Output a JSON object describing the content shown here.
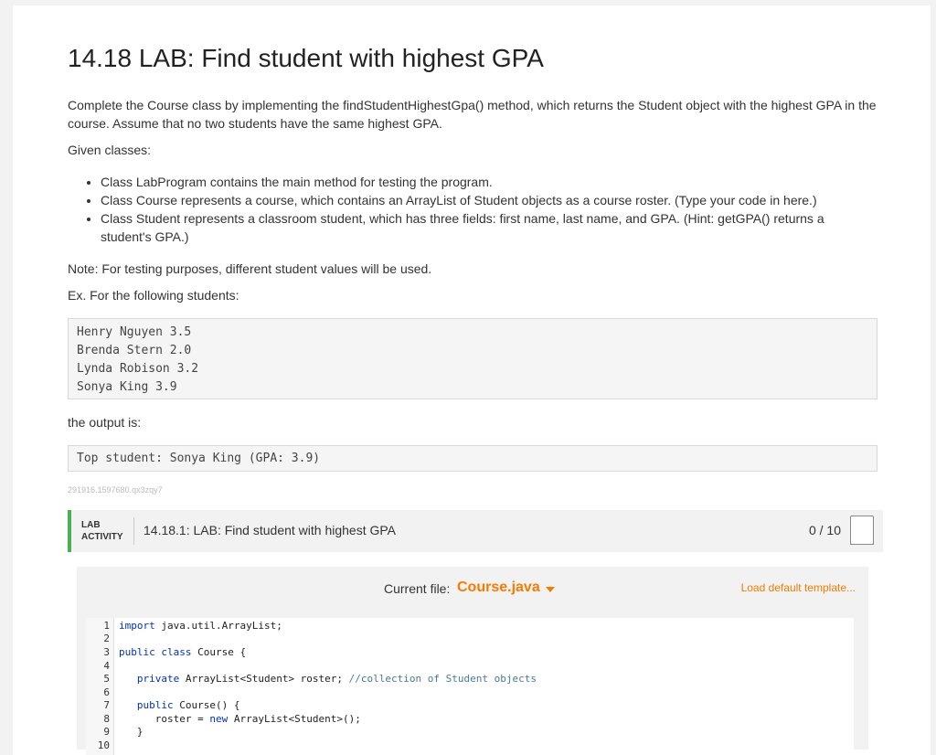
{
  "lab": {
    "title": "14.18 LAB: Find student with highest GPA",
    "intro": "Complete the Course class by implementing the findStudentHighestGpa() method, which returns the Student object with the highest GPA in the course. Assume that no two students have the same highest GPA.",
    "given_label": "Given classes:",
    "bullets": [
      "Class LabProgram contains the main method for testing the program.",
      "Class Course represents a course, which contains an ArrayList of Student objects as a course roster. (Type your code in here.)",
      "Class Student represents a classroom student, which has three fields: first name, last name, and GPA. (Hint: getGPA() returns a student's GPA.)"
    ],
    "note": "Note: For testing purposes, different student values will be used.",
    "example_label": "Ex. For the following students:",
    "students": [
      "Henry Nguyen 3.5",
      "Brenda Stern 2.0",
      "Lynda Robison 3.2",
      "Sonya King 3.9"
    ],
    "output_label": "the output is:",
    "output": "Top student: Sonya King (GPA: 3.9)",
    "identifier": "291916.1597680.qx3zqy7"
  },
  "activity": {
    "tag_line1": "LAB",
    "tag_line2": "ACTIVITY",
    "title": "14.18.1: LAB: Find student with highest GPA",
    "score": "0 / 10",
    "accent": "#4caf50"
  },
  "editor": {
    "current_file_label": "Current file:",
    "current_file": "Course.java",
    "load_template": "Load default template...",
    "accent": "#f57c00",
    "lines": [
      {
        "n": "1",
        "code": [
          {
            "t": "import",
            "k": "kw"
          },
          {
            "t": " java.util.ArrayList;"
          }
        ]
      },
      {
        "n": "2",
        "code": []
      },
      {
        "n": "3",
        "code": [
          {
            "t": "public",
            "k": "kw"
          },
          {
            "t": " "
          },
          {
            "t": "class",
            "k": "kw"
          },
          {
            "t": " Course {"
          }
        ]
      },
      {
        "n": "4",
        "code": []
      },
      {
        "n": "5",
        "code": [
          {
            "t": "   "
          },
          {
            "t": "private",
            "k": "kw"
          },
          {
            "t": " ArrayList<Student> roster; "
          },
          {
            "t": "//collection of Student objects",
            "k": "cm"
          }
        ]
      },
      {
        "n": "6",
        "code": []
      },
      {
        "n": "7",
        "code": [
          {
            "t": "   "
          },
          {
            "t": "public",
            "k": "kw"
          },
          {
            "t": " Course() {"
          }
        ]
      },
      {
        "n": "8",
        "code": [
          {
            "t": "      roster = "
          },
          {
            "t": "new",
            "k": "kw"
          },
          {
            "t": " ArrayList<Student>();"
          }
        ]
      },
      {
        "n": "9",
        "code": [
          {
            "t": "   }"
          }
        ]
      },
      {
        "n": "10",
        "code": []
      }
    ]
  }
}
